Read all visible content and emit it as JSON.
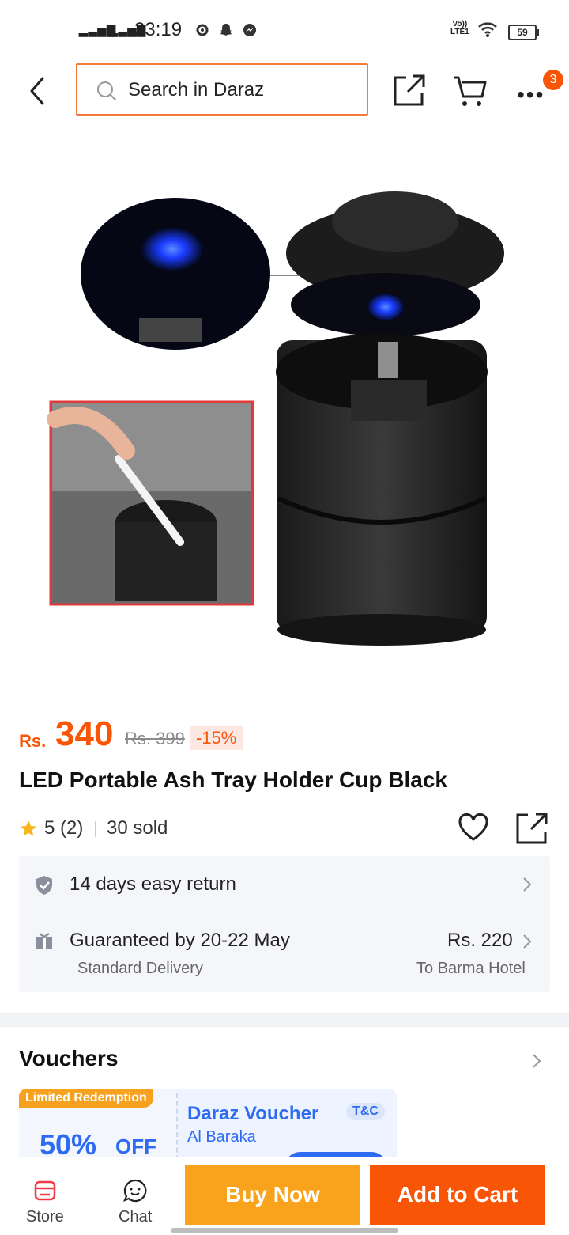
{
  "status_bar": {
    "time": "23:19",
    "battery": "59",
    "volte_line1": "Vo))",
    "volte_line2": "LTE1"
  },
  "header": {
    "search_placeholder": "Search in Daraz",
    "cart_badge": "3",
    "icons": [
      "back-arrow-icon",
      "search-icon",
      "share-icon",
      "cart-icon",
      "more-icon"
    ]
  },
  "product": {
    "currency": "Rs.",
    "price": "340",
    "original_price": "Rs. 399",
    "discount": "-15%",
    "title": "LED Portable Ash Tray Holder Cup Black",
    "rating": "5 (2)",
    "sold": "30 sold"
  },
  "delivery": {
    "return_policy": "14 days easy return",
    "guarantee": "Guaranteed by 20-22 May",
    "fee": "Rs. 220",
    "method": "Standard Delivery",
    "destination": "To Barma Hotel"
  },
  "vouchers": {
    "heading": "Vouchers",
    "items": [
      {
        "tag": "Limited Redemption",
        "percent": "50%",
        "off": "OFF",
        "name": "Daraz Voucher",
        "store": "Al Baraka",
        "terms": "T&C"
      }
    ]
  },
  "bottom_bar": {
    "store_label": "Store",
    "chat_label": "Chat",
    "buy_now": "Buy Now",
    "add_to_cart": "Add to Cart"
  },
  "colors": {
    "brand_orange": "#f85606",
    "buy_now_yellow": "#f8a31b",
    "voucher_blue": "#2e6bf2"
  }
}
